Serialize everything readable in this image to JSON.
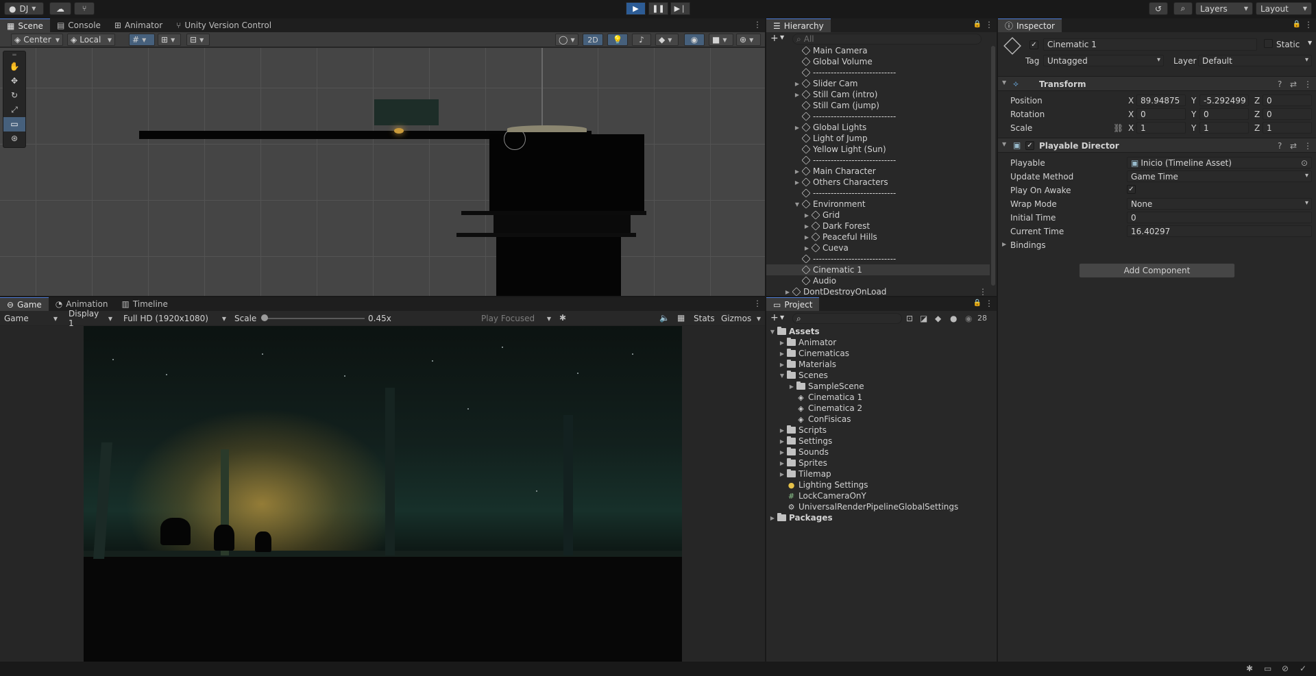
{
  "toolbar": {
    "account": "DJ",
    "layers": "Layers",
    "layout": "Layout"
  },
  "scene": {
    "tabs": [
      "Scene",
      "Console",
      "Animator",
      "Unity Version Control"
    ],
    "pivot": "Center",
    "space": "Local",
    "mode_2d": "2D"
  },
  "game": {
    "tabs": [
      "Game",
      "Animation",
      "Timeline"
    ],
    "view": "Game",
    "display": "Display 1",
    "resolution": "Full HD (1920x1080)",
    "scale_label": "Scale",
    "scale_value": "0.45x",
    "play_focused": "Play Focused",
    "stats": "Stats",
    "gizmos": "Gizmos"
  },
  "hierarchy": {
    "title": "Hierarchy",
    "search_placeholder": "All",
    "items": [
      {
        "label": "Main Camera",
        "depth": 1,
        "arrow": ""
      },
      {
        "label": "Global Volume",
        "depth": 1,
        "arrow": ""
      },
      {
        "label": "----------------------------",
        "depth": 1,
        "arrow": ""
      },
      {
        "label": "Slider Cam",
        "depth": 1,
        "arrow": "▶"
      },
      {
        "label": "Still Cam (intro)",
        "depth": 1,
        "arrow": "▶"
      },
      {
        "label": "Still Cam (jump)",
        "depth": 1,
        "arrow": ""
      },
      {
        "label": "----------------------------",
        "depth": 1,
        "arrow": ""
      },
      {
        "label": "Global Lights",
        "depth": 1,
        "arrow": "▶"
      },
      {
        "label": "Light of Jump",
        "depth": 1,
        "arrow": ""
      },
      {
        "label": "Yellow Light (Sun)",
        "depth": 1,
        "arrow": ""
      },
      {
        "label": "----------------------------",
        "depth": 1,
        "arrow": ""
      },
      {
        "label": "Main Character",
        "depth": 1,
        "arrow": "▶"
      },
      {
        "label": "Others Characters",
        "depth": 1,
        "arrow": "▶"
      },
      {
        "label": "----------------------------",
        "depth": 1,
        "arrow": ""
      },
      {
        "label": "Environment",
        "depth": 1,
        "arrow": "▼"
      },
      {
        "label": "Grid",
        "depth": 2,
        "arrow": "▶"
      },
      {
        "label": "Dark Forest",
        "depth": 2,
        "arrow": "▶"
      },
      {
        "label": "Peaceful Hills",
        "depth": 2,
        "arrow": "▶"
      },
      {
        "label": "Cueva",
        "depth": 2,
        "arrow": "▶"
      },
      {
        "label": "----------------------------",
        "depth": 1,
        "arrow": ""
      },
      {
        "label": "Cinematic 1",
        "depth": 1,
        "arrow": "",
        "selected": true
      },
      {
        "label": "Audio",
        "depth": 1,
        "arrow": ""
      },
      {
        "label": "DontDestroyOnLoad",
        "depth": 0,
        "arrow": "▶"
      }
    ]
  },
  "project": {
    "title": "Project",
    "badge": "28",
    "items": [
      {
        "label": "Assets",
        "depth": 0,
        "arrow": "▼",
        "type": "folder",
        "bold": true
      },
      {
        "label": "Animator",
        "depth": 1,
        "arrow": "▶",
        "type": "folder"
      },
      {
        "label": "Cinematicas",
        "depth": 1,
        "arrow": "▶",
        "type": "folder"
      },
      {
        "label": "Materials",
        "depth": 1,
        "arrow": "▶",
        "type": "folder"
      },
      {
        "label": "Scenes",
        "depth": 1,
        "arrow": "▼",
        "type": "folder"
      },
      {
        "label": "SampleScene",
        "depth": 2,
        "arrow": "▶",
        "type": "folder"
      },
      {
        "label": "Cinematica 1",
        "depth": 2,
        "arrow": "",
        "type": "scene"
      },
      {
        "label": "Cinematica 2",
        "depth": 2,
        "arrow": "",
        "type": "scene"
      },
      {
        "label": "ConFisicas",
        "depth": 2,
        "arrow": "",
        "type": "scene"
      },
      {
        "label": "Scripts",
        "depth": 1,
        "arrow": "▶",
        "type": "folder"
      },
      {
        "label": "Settings",
        "depth": 1,
        "arrow": "▶",
        "type": "folder"
      },
      {
        "label": "Sounds",
        "depth": 1,
        "arrow": "▶",
        "type": "folder"
      },
      {
        "label": "Sprites",
        "depth": 1,
        "arrow": "▶",
        "type": "folder"
      },
      {
        "label": "Tilemap",
        "depth": 1,
        "arrow": "▶",
        "type": "folder"
      },
      {
        "label": "Lighting Settings",
        "depth": 1,
        "arrow": "",
        "type": "light"
      },
      {
        "label": "LockCameraOnY",
        "depth": 1,
        "arrow": "",
        "type": "script"
      },
      {
        "label": "UniversalRenderPipelineGlobalSettings",
        "depth": 1,
        "arrow": "",
        "type": "asset"
      },
      {
        "label": "Packages",
        "depth": 0,
        "arrow": "▶",
        "type": "folder",
        "bold": true
      }
    ]
  },
  "inspector": {
    "title": "Inspector",
    "object_name": "Cinematic 1",
    "static_label": "Static",
    "tag_label": "Tag",
    "tag_value": "Untagged",
    "layer_label": "Layer",
    "layer_value": "Default",
    "transform": {
      "title": "Transform",
      "position_label": "Position",
      "rotation_label": "Rotation",
      "scale_label": "Scale",
      "position": {
        "x": "89.94875",
        "y": "-5.292499",
        "z": "0"
      },
      "rotation": {
        "x": "0",
        "y": "0",
        "z": "0"
      },
      "scale": {
        "x": "1",
        "y": "1",
        "z": "1"
      },
      "axis": {
        "x": "X",
        "y": "Y",
        "z": "Z"
      }
    },
    "director": {
      "title": "Playable Director",
      "playable_label": "Playable",
      "playable_value": "Inicio (Timeline Asset)",
      "update_label": "Update Method",
      "update_value": "Game Time",
      "play_on_awake_label": "Play On Awake",
      "wrap_label": "Wrap Mode",
      "wrap_value": "None",
      "initial_label": "Initial Time",
      "initial_value": "0",
      "current_label": "Current Time",
      "current_value": "16.40297",
      "bindings_label": "Bindings"
    },
    "add_component": "Add Component"
  },
  "colors": {
    "accent": "#4d7bd6",
    "selection": "#3a3a3a",
    "play_active": "#2d5c95"
  }
}
